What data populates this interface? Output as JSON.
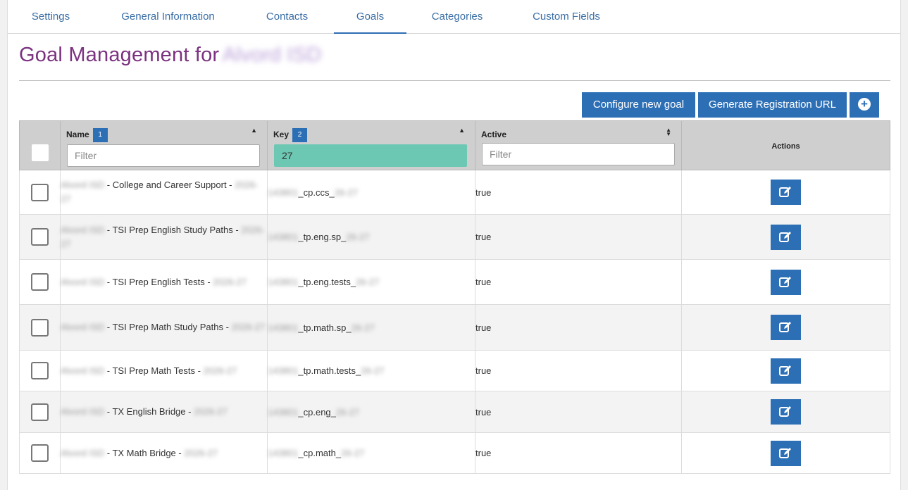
{
  "tabs": [
    {
      "label": "Settings"
    },
    {
      "label": "General Information"
    },
    {
      "label": "Contacts"
    },
    {
      "label": "Goals",
      "active": true
    },
    {
      "label": "Categories"
    },
    {
      "label": "Custom Fields"
    }
  ],
  "page": {
    "title_prefix": "Goal Management for",
    "title_org": "Alvord ISD"
  },
  "toolbar": {
    "configure_label": "Configure new goal",
    "generate_label": "Generate Registration URL",
    "add_icon": "plus-circle-icon"
  },
  "table": {
    "columns": {
      "name": {
        "label": "Name",
        "badge": "1"
      },
      "key": {
        "label": "Key",
        "badge": "2"
      },
      "active": {
        "label": "Active"
      },
      "actions": {
        "label": "Actions"
      }
    },
    "filters": {
      "name_placeholder": "Filter",
      "key_value": "27",
      "active_placeholder": "Filter"
    },
    "rows": [
      {
        "name_pre": "Alvord ISD",
        "name_mid": " - College and Career Support - ",
        "name_post": "2026-27",
        "key_pre": "143801",
        "key_mid": "_cp.ccs_",
        "key_post": "26-27",
        "active": "true"
      },
      {
        "name_pre": "Alvord ISD",
        "name_mid": " - TSI Prep English Study Paths - ",
        "name_post": "2026-27",
        "key_pre": "143801",
        "key_mid": "_tp.eng.sp_",
        "key_post": "26-27",
        "active": "true"
      },
      {
        "name_pre": "Alvord ISD",
        "name_mid": " - TSI Prep English Tests - ",
        "name_post": "2026-27",
        "key_pre": "143801",
        "key_mid": "_tp.eng.tests_",
        "key_post": "26-27",
        "active": "true"
      },
      {
        "name_pre": "Alvord ISD",
        "name_mid": " - TSI Prep Math Study Paths - ",
        "name_post": "2026-27",
        "key_pre": "143801",
        "key_mid": "_tp.math.sp_",
        "key_post": "26-27",
        "active": "true"
      },
      {
        "name_pre": "Alvord ISD",
        "name_mid": " - TSI Prep Math Tests - ",
        "name_post": "2026-27",
        "key_pre": "143801",
        "key_mid": "_tp.math.tests_",
        "key_post": "26-27",
        "active": "true"
      },
      {
        "name_pre": "Alvord ISD",
        "name_mid": " - TX English Bridge - ",
        "name_post": "2026-27",
        "key_pre": "143801",
        "key_mid": "_cp.eng_",
        "key_post": "26-27",
        "active": "true"
      },
      {
        "name_pre": "Alvord ISD",
        "name_mid": " - TX Math Bridge - ",
        "name_post": "2026-27",
        "key_pre": "143801",
        "key_mid": "_cp.math_",
        "key_post": "26-27",
        "active": "true"
      }
    ]
  },
  "colors": {
    "accent": "#2d6fb5",
    "title": "#7b3280",
    "filter_active": "#6cc8b3"
  }
}
